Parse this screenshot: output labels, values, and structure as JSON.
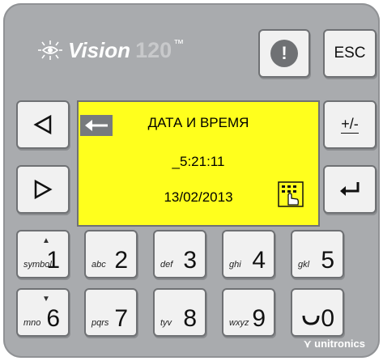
{
  "brand": {
    "name": "Vision",
    "model": "120",
    "trademark": "™",
    "maker": "unitronics"
  },
  "buttons": {
    "alert": "!",
    "esc": "ESC",
    "plus_minus": "+/-"
  },
  "screen": {
    "title": "ДАТА И ВРЕМЯ",
    "time": "_5:21:11",
    "date": "13/02/2013"
  },
  "keypad": [
    {
      "sub": "symbol",
      "num": "1",
      "arrow": "▲"
    },
    {
      "sub": "abc",
      "num": "2"
    },
    {
      "sub": "def",
      "num": "3"
    },
    {
      "sub": "ghi",
      "num": "4"
    },
    {
      "sub": "gkl",
      "num": "5"
    },
    {
      "sub": "mno",
      "num": "6",
      "arrow": "▼"
    },
    {
      "sub": "pqrs",
      "num": "7"
    },
    {
      "sub": "tyv",
      "num": "8"
    },
    {
      "sub": "wxyz",
      "num": "9"
    },
    {
      "sub": "",
      "num": "0"
    }
  ],
  "colors": {
    "panel": "#a9abae",
    "screen": "#ffff1d",
    "key": "#f1f1f1"
  }
}
